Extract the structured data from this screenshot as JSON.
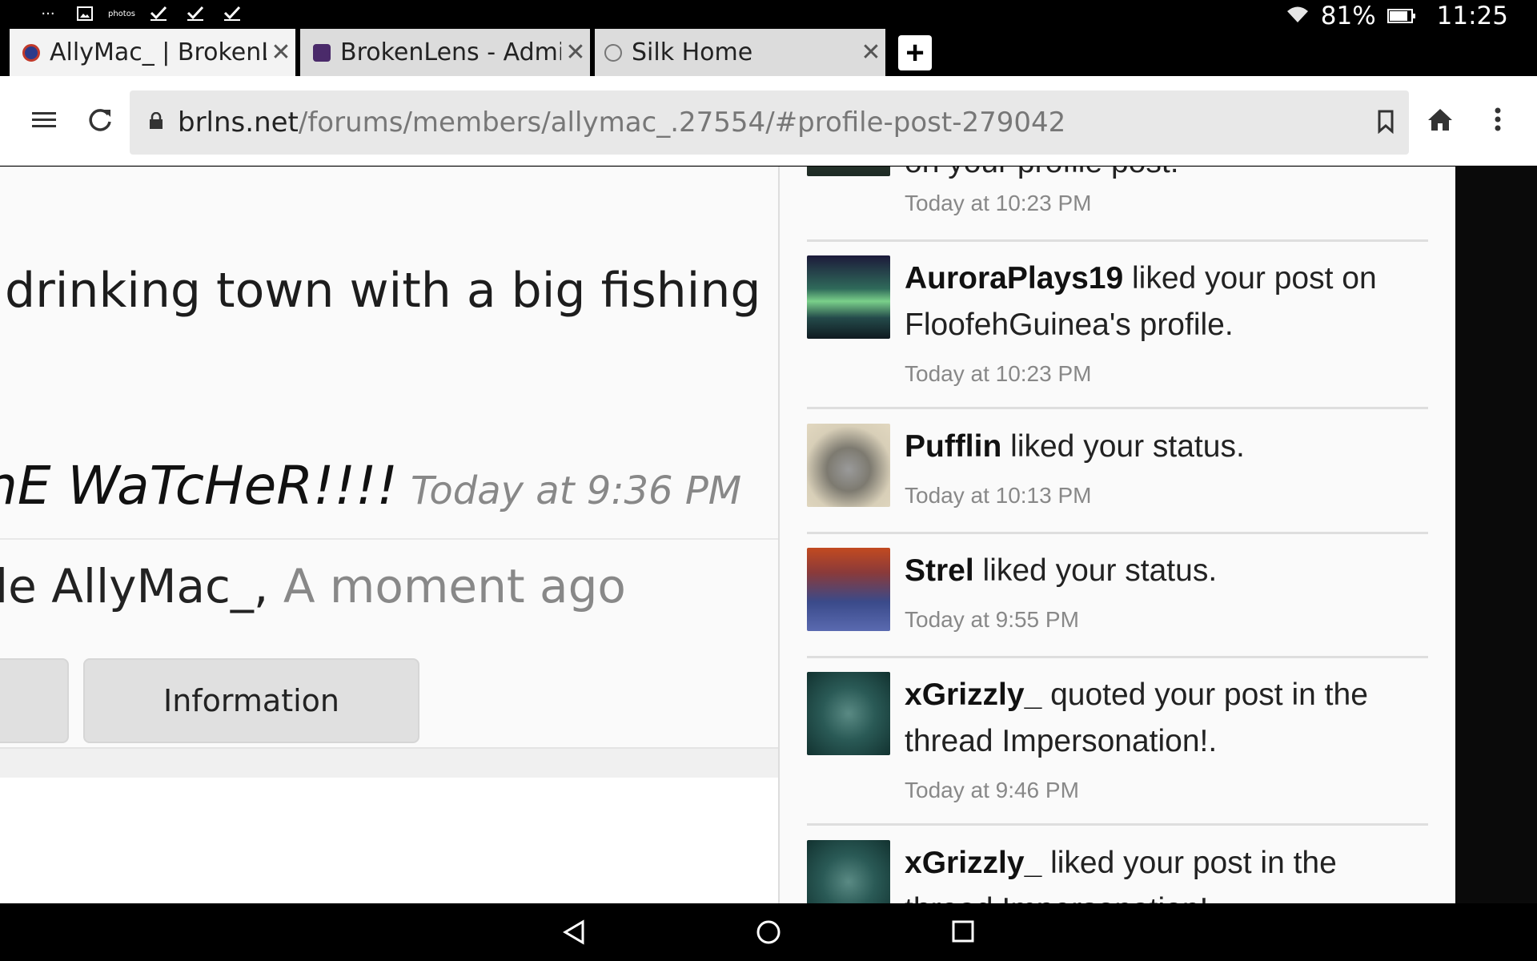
{
  "status_bar": {
    "left_icons": [
      "more-icon",
      "image-icon",
      "photos-icon",
      "check-icon",
      "check-icon",
      "check-icon"
    ],
    "battery": "81%",
    "time": "11:25"
  },
  "tabs": [
    {
      "label": "AllyMac_ | BrokenLens",
      "active": true,
      "favicon_color": "#c0392b"
    },
    {
      "label": "BrokenLens - Admin",
      "active": false,
      "favicon_color": "#4a2a6a"
    },
    {
      "label": "Silk Home",
      "active": false,
      "favicon_color": "#777777"
    }
  ],
  "toolbar": {
    "url_domain": "brlns.net",
    "url_path": "/forums/members/allymac_.27554/#profile-post-279042"
  },
  "page": {
    "status_text": "drinking town with a big fishing probl",
    "status_name": "hE WaTcHeR!!!!",
    "status_time": "Today at 9:36 PM",
    "comment_author": "le AllyMac_,",
    "comment_time": "A moment ago",
    "button_information": "Information"
  },
  "alerts": {
    "top_partial_text": "on your profile post.",
    "top_partial_time": "Today at 10:23 PM",
    "items": [
      {
        "user": "AuroraPlays19",
        "action": " liked your post on FloofehGuinea's profile.",
        "time": "Today at 10:23 PM",
        "avatar": "aurora"
      },
      {
        "user": "Pufflin",
        "action": " liked your status.",
        "time": "Today at 10:13 PM",
        "avatar": "snowman-light"
      },
      {
        "user": "Strel",
        "action": " liked your status.",
        "time": "Today at 9:55 PM",
        "avatar": "snowman-fire"
      },
      {
        "user": "xGrizzly_",
        "action": " quoted your post in the thread Impersonation!.",
        "time": "Today at 9:46 PM",
        "avatar": "snowman-teal"
      },
      {
        "user": "xGrizzly_",
        "action": " liked your post in the thread Impersonation!.",
        "time": "",
        "avatar": "snowman-teal"
      }
    ]
  }
}
